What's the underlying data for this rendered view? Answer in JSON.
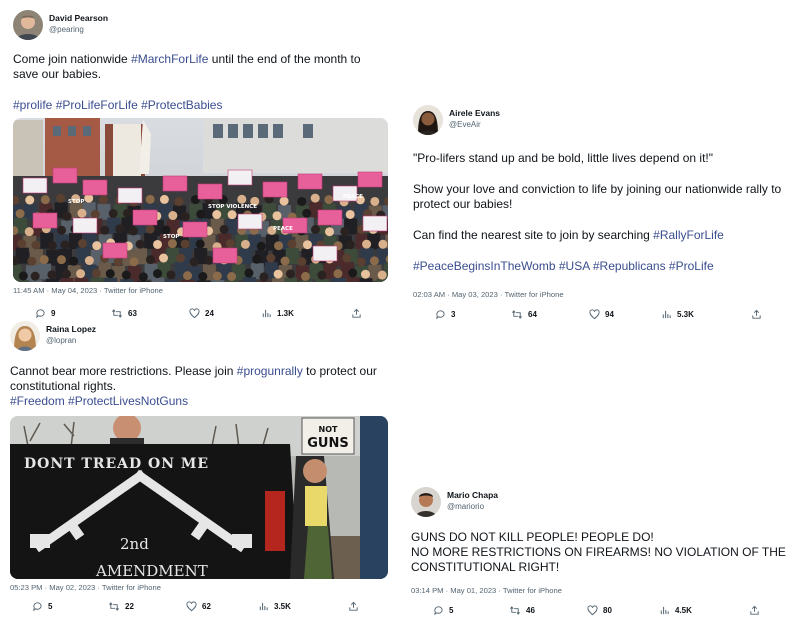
{
  "tweets": [
    {
      "name": "David Pearson",
      "handle": "@pearing",
      "text": [
        {
          "t": "Come join nationwide "
        },
        {
          "t": "#MarchForLife",
          "tag": true
        },
        {
          "t": " until the end of the month to save our babies."
        }
      ],
      "hashtags": [
        "#prolife",
        "#ProLifeForLife",
        "#ProtectBabies"
      ],
      "image_signs": [
        "STOP",
        "PEACE",
        "STOP VIOLENCE",
        "PEACE",
        "STOP",
        "PEACE"
      ],
      "timestamp": "11:45 AM · May 04, 2023 · Twitter for iPhone",
      "stats": {
        "replies": "9",
        "retweets": "63",
        "likes": "24",
        "views": "1.3K"
      }
    },
    {
      "name": "Airele Evans",
      "handle": "@EveAir",
      "paragraphs": [
        [
          {
            "t": "\"Pro-lifers stand up and be bold, little lives depend on it!\""
          }
        ],
        [
          {
            "t": "Show your love and conviction to life by joining our nationwide rally to protect our babies!"
          }
        ],
        [
          {
            "t": "Can find the nearest site to join by searching "
          },
          {
            "t": "#RallyForLife",
            "tag": true
          }
        ],
        [
          {
            "t": "#PeaceBeginsInTheWomb #USA #Republicans #ProLife",
            "tag": true
          }
        ]
      ],
      "timestamp": "02:03 AM · May 03, 2023 · Twitter for iPhone",
      "stats": {
        "replies": "3",
        "retweets": "64",
        "likes": "94",
        "views": "5.3K"
      }
    },
    {
      "name": "Raina Lopez",
      "handle": "@lopran",
      "text": [
        {
          "t": "Cannot bear more restrictions. Please join "
        },
        {
          "t": "#progunrally",
          "tag": true
        },
        {
          "t": " to protect our constitutional rights."
        }
      ],
      "hashtags": [
        "#Freedom",
        "#ProtectLivesNotGuns"
      ],
      "image_signs": {
        "sign": "NOT GUNS",
        "flag_top": "DONT TREAD ON ME",
        "flag_mid": "2nd",
        "flag_bottom": "AMENDMENT"
      },
      "timestamp": "05:23 PM · May 02, 2023 · Twitter for iPhone",
      "stats": {
        "replies": "5",
        "retweets": "22",
        "likes": "62",
        "views": "3.5K"
      }
    },
    {
      "name": "Mario Chapa",
      "handle": "@mariorio",
      "lines": [
        "GUNS DO NOT KILL PEOPLE! PEOPLE DO!",
        "NO MORE RESTRICTIONS ON FIREARMS! NO VIOLATION OF THE CONSTITUTIONAL RIGHT!"
      ],
      "timestamp": "03:14 PM · May 01, 2023 · Twitter for iPhone",
      "stats": {
        "replies": "5",
        "retweets": "46",
        "likes": "80",
        "views": "4.5K"
      }
    }
  ],
  "colors": {
    "hashtag": "#3a4d8f",
    "text": "#0f1419",
    "muted": "#536471",
    "protest_pink": "#e8609a"
  },
  "icons": [
    "reply-icon",
    "retweet-icon",
    "like-icon",
    "views-icon",
    "share-icon"
  ]
}
